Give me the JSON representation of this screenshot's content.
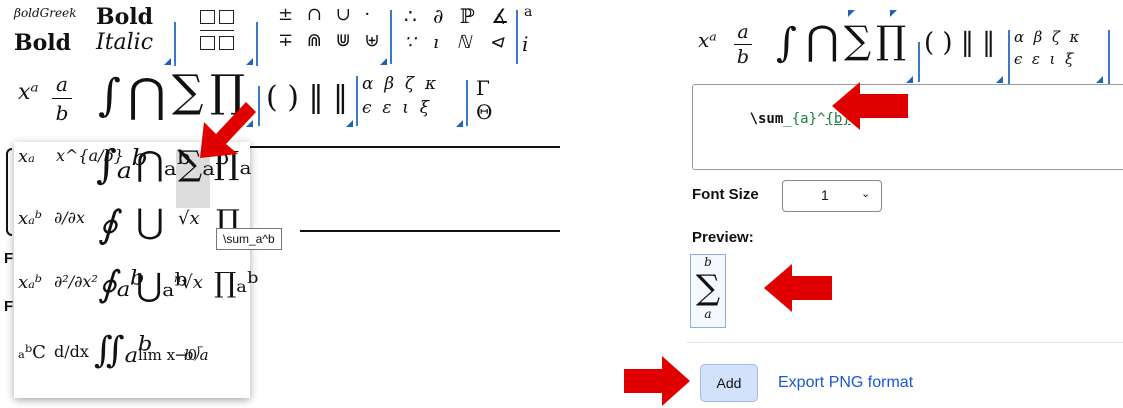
{
  "left_panel": {
    "toolbar_row1": {
      "style_bold_green": "𝛽𝑜𝑙𝑑𝐺𝑟𝑒𝑒𝑘",
      "style_bold": "Bold",
      "style_bold_upright": "Bold",
      "style_italic": "Italic",
      "operators_a": "± ∩ ∪ ·",
      "operators_b": "∓ ⋒ ⋓ ⊎",
      "relations_a": "∴ ∂ ℙ ∡",
      "relations_b": "∵ 𝚤 ℕ ⊲",
      "trailing_a": "a",
      "trailing_b": "i"
    },
    "toolbar_row2": {
      "superscript": "xᵃ",
      "frac_num": "a",
      "frac_den": "b",
      "integral": "∫",
      "bigcap": "⋂",
      "sum": "∑",
      "prod": "∏",
      "brackets": "( ) ‖ ‖",
      "greek_top": "α  β  ζ  κ",
      "greek_bottom": "ϵ  ε  ι  ξ",
      "upper_top": "Γ",
      "upper_bottom": "Θ"
    },
    "dropdown": {
      "rows": [
        [
          "xₐ",
          "x^{a/b}",
          "∫ₐᵇ",
          "⋂ₐᵇ",
          "∑ₐᵇ",
          "∏ₐ"
        ],
        [
          "xₐᵇ",
          "∂/∂x",
          "∮",
          "⋃",
          "√x",
          "∏"
        ],
        [
          "xₐᵇ",
          "∂²/∂x²",
          "∮ₐᵇ",
          "⋃ₐᵇ",
          "ⁿ√x",
          "∏ₐᵇ"
        ],
        [
          "ₐᵇC",
          "d/dx",
          "∬ₐᵇ",
          "lim x→0",
          "b⟌a",
          ""
        ]
      ],
      "tooltip": "\\sum_a^b"
    },
    "partial_labels": [
      "F",
      "F"
    ]
  },
  "right_panel": {
    "toolbar": {
      "superscript": "xᵃ",
      "frac_num": "a",
      "frac_den": "b",
      "integral": "∫",
      "bigcap": "⋂",
      "sum": "∑",
      "prod": "∏",
      "brackets": "( ) ‖ ‖",
      "greek_top": "α  β  ζ  κ",
      "greek_bottom": "ϵ  ε  ι  ξ"
    },
    "editor": {
      "code_cmd": "\\sum",
      "code_sub": "_{a}",
      "code_sup_pre": "^",
      "code_sup_u": "{b}"
    },
    "font_size": {
      "label": "Font Size",
      "value": "1"
    },
    "preview": {
      "label": "Preview:",
      "upper": "b",
      "symbol": "∑",
      "lower": "a"
    },
    "actions": {
      "add_label": "Add",
      "export_label": "Export PNG format"
    }
  },
  "colors": {
    "accent_blue": "#1e63b5",
    "arrow_red": "#e00000",
    "link_blue": "#1a57d6",
    "code_green": "#1a7f37",
    "add_button_bg": "#d3e2fb"
  }
}
